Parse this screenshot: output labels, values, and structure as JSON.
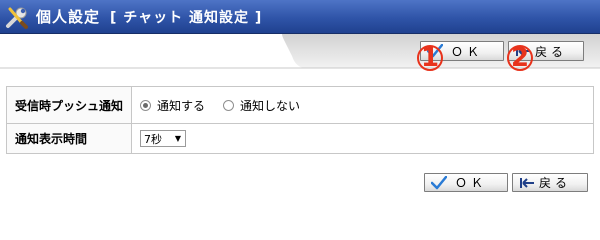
{
  "window": {
    "title": "個人設定",
    "subtitle": "[ チャット 通知設定 ]"
  },
  "toolbar": {
    "ok_label": "ＯＫ",
    "back_label": "戻る",
    "marker_1": "1",
    "marker_2": "2"
  },
  "form": {
    "push_notify": {
      "label": "受信時プッシュ通知",
      "options": [
        "通知する",
        "通知しない"
      ],
      "selected": "通知する"
    },
    "display_time": {
      "label": "通知表示時間",
      "value": "7秒"
    }
  },
  "footer": {
    "ok_label": "ＯＫ",
    "back_label": "戻る"
  },
  "icons": {
    "title": "tools-icon",
    "ok": "checkmark-icon",
    "back": "back-arrow-icon"
  },
  "colors": {
    "titlebar": "#2f54a8",
    "marker": "#e8331c",
    "check": "#2a7bd5"
  }
}
